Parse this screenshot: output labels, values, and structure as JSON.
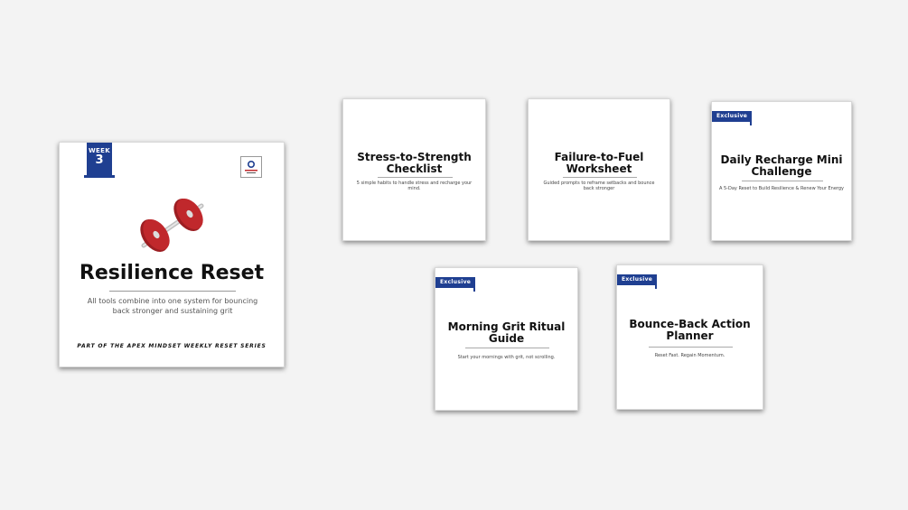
{
  "main_card": {
    "week_label": "WEEK",
    "week_number": "3",
    "title": "Resilience Reset",
    "subtitle": "All tools combine into one system for bouncing back stronger and sustaining grit",
    "footer": "PART OF THE APEX MINDSET WEEKLY RESET SERIES",
    "logo_icon": "brand-logo-icon",
    "illustration_icon": "dumbbell-icon"
  },
  "cards": [
    {
      "title": "Stress-to-Strength Checklist",
      "description": "5 simple habits to handle stress and recharge your mind."
    },
    {
      "title": "Failure-to-Fuel Worksheet",
      "description": "Guided prompts to reframe setbacks and bounce back stronger"
    },
    {
      "badge": "Exclusive",
      "title": "Daily Recharge Mini Challenge",
      "description": "A 5-Day Reset to Build Resilience & Renew Your Energy"
    },
    {
      "badge": "Exclusive",
      "title": "Morning Grit Ritual Guide",
      "description": "Start your mornings with grit, not scrolling."
    },
    {
      "badge": "Exclusive",
      "title": "Bounce-Back Action Planner",
      "description": "Reset Fast. Regain Momentum."
    }
  ],
  "colors": {
    "background": "#f3f3f3",
    "accent_blue": "#1f3f91",
    "dumbbell_red": "#c0282c"
  }
}
